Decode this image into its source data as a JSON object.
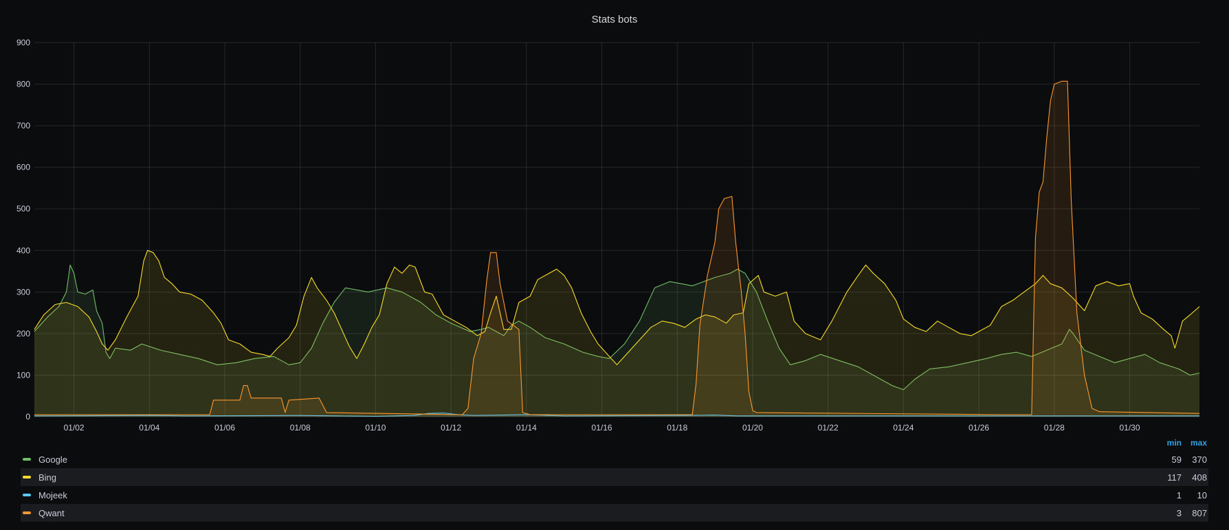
{
  "chart_data": {
    "type": "area",
    "title": "Stats bots",
    "xlabel": "",
    "ylabel": "",
    "x_ticks": [
      "01/02",
      "01/04",
      "01/06",
      "01/08",
      "01/10",
      "01/12",
      "01/14",
      "01/16",
      "01/18",
      "01/20",
      "01/22",
      "01/24",
      "01/26",
      "01/28",
      "01/30"
    ],
    "x_range": [
      0.95,
      31.85
    ],
    "y_ticks": [
      0,
      100,
      200,
      300,
      400,
      500,
      600,
      700,
      800,
      900
    ],
    "ylim": [
      0,
      900
    ],
    "grid": true,
    "legend_placement": "bottom",
    "legend_columns": [
      "min",
      "max"
    ],
    "series": [
      {
        "name": "Google",
        "color": "#73bf69",
        "min": 59,
        "max": 370,
        "points": [
          [
            0.95,
            205
          ],
          [
            1.3,
            240
          ],
          [
            1.6,
            265
          ],
          [
            1.8,
            300
          ],
          [
            1.9,
            365
          ],
          [
            2.0,
            345
          ],
          [
            2.1,
            300
          ],
          [
            2.3,
            295
          ],
          [
            2.5,
            305
          ],
          [
            2.6,
            255
          ],
          [
            2.75,
            225
          ],
          [
            2.85,
            155
          ],
          [
            2.95,
            140
          ],
          [
            3.1,
            165
          ],
          [
            3.5,
            160
          ],
          [
            3.8,
            175
          ],
          [
            4.3,
            160
          ],
          [
            4.8,
            150
          ],
          [
            5.3,
            140
          ],
          [
            5.8,
            125
          ],
          [
            6.3,
            130
          ],
          [
            6.8,
            140
          ],
          [
            7.3,
            145
          ],
          [
            7.7,
            125
          ],
          [
            8.0,
            130
          ],
          [
            8.3,
            165
          ],
          [
            8.6,
            225
          ],
          [
            8.9,
            275
          ],
          [
            9.2,
            310
          ],
          [
            9.5,
            305
          ],
          [
            9.8,
            300
          ],
          [
            10.3,
            310
          ],
          [
            10.7,
            300
          ],
          [
            11.2,
            275
          ],
          [
            11.6,
            245
          ],
          [
            12.0,
            225
          ],
          [
            12.5,
            205
          ],
          [
            12.8,
            210
          ],
          [
            13.0,
            215
          ],
          [
            13.2,
            205
          ],
          [
            13.4,
            195
          ],
          [
            13.6,
            220
          ],
          [
            13.8,
            230
          ],
          [
            14.1,
            215
          ],
          [
            14.5,
            190
          ],
          [
            15.0,
            175
          ],
          [
            15.5,
            155
          ],
          [
            15.9,
            145
          ],
          [
            16.2,
            140
          ],
          [
            16.6,
            175
          ],
          [
            17.0,
            230
          ],
          [
            17.4,
            310
          ],
          [
            17.8,
            325
          ],
          [
            18.1,
            320
          ],
          [
            18.4,
            315
          ],
          [
            18.7,
            325
          ],
          [
            19.0,
            335
          ],
          [
            19.4,
            345
          ],
          [
            19.6,
            355
          ],
          [
            19.8,
            345
          ],
          [
            20.1,
            300
          ],
          [
            20.4,
            230
          ],
          [
            20.7,
            165
          ],
          [
            21.0,
            125
          ],
          [
            21.4,
            135
          ],
          [
            21.8,
            150
          ],
          [
            22.3,
            135
          ],
          [
            22.8,
            120
          ],
          [
            23.3,
            95
          ],
          [
            23.7,
            75
          ],
          [
            24.0,
            65
          ],
          [
            24.3,
            90
          ],
          [
            24.7,
            115
          ],
          [
            25.2,
            120
          ],
          [
            25.7,
            130
          ],
          [
            26.2,
            140
          ],
          [
            26.6,
            150
          ],
          [
            27.0,
            155
          ],
          [
            27.4,
            145
          ],
          [
            27.8,
            160
          ],
          [
            28.2,
            175
          ],
          [
            28.4,
            210
          ],
          [
            28.5,
            200
          ],
          [
            28.8,
            160
          ],
          [
            29.2,
            145
          ],
          [
            29.6,
            130
          ],
          [
            30.0,
            140
          ],
          [
            30.4,
            150
          ],
          [
            30.8,
            130
          ],
          [
            31.3,
            115
          ],
          [
            31.6,
            100
          ],
          [
            31.85,
            105
          ]
        ]
      },
      {
        "name": "Bing",
        "color": "#fade2a",
        "min": 117,
        "max": 408,
        "points": [
          [
            0.95,
            210
          ],
          [
            1.2,
            245
          ],
          [
            1.5,
            270
          ],
          [
            1.8,
            275
          ],
          [
            2.1,
            265
          ],
          [
            2.4,
            240
          ],
          [
            2.6,
            205
          ],
          [
            2.75,
            175
          ],
          [
            2.9,
            160
          ],
          [
            3.1,
            185
          ],
          [
            3.4,
            240
          ],
          [
            3.7,
            290
          ],
          [
            3.85,
            375
          ],
          [
            3.95,
            400
          ],
          [
            4.1,
            395
          ],
          [
            4.25,
            375
          ],
          [
            4.4,
            335
          ],
          [
            4.6,
            320
          ],
          [
            4.8,
            300
          ],
          [
            5.1,
            295
          ],
          [
            5.4,
            280
          ],
          [
            5.7,
            250
          ],
          [
            5.9,
            225
          ],
          [
            6.1,
            185
          ],
          [
            6.4,
            175
          ],
          [
            6.7,
            155
          ],
          [
            7.0,
            150
          ],
          [
            7.2,
            145
          ],
          [
            7.4,
            165
          ],
          [
            7.7,
            190
          ],
          [
            7.9,
            220
          ],
          [
            8.1,
            290
          ],
          [
            8.3,
            335
          ],
          [
            8.45,
            310
          ],
          [
            8.7,
            280
          ],
          [
            8.9,
            250
          ],
          [
            9.1,
            210
          ],
          [
            9.3,
            170
          ],
          [
            9.5,
            140
          ],
          [
            9.7,
            175
          ],
          [
            9.9,
            215
          ],
          [
            10.1,
            245
          ],
          [
            10.3,
            320
          ],
          [
            10.5,
            360
          ],
          [
            10.7,
            345
          ],
          [
            10.9,
            365
          ],
          [
            11.05,
            360
          ],
          [
            11.3,
            300
          ],
          [
            11.5,
            295
          ],
          [
            11.8,
            245
          ],
          [
            12.1,
            230
          ],
          [
            12.4,
            215
          ],
          [
            12.7,
            195
          ],
          [
            12.9,
            205
          ],
          [
            13.05,
            250
          ],
          [
            13.2,
            290
          ],
          [
            13.4,
            210
          ],
          [
            13.6,
            210
          ],
          [
            13.8,
            275
          ],
          [
            14.1,
            290
          ],
          [
            14.3,
            330
          ],
          [
            14.6,
            345
          ],
          [
            14.8,
            355
          ],
          [
            15.0,
            340
          ],
          [
            15.2,
            310
          ],
          [
            15.45,
            250
          ],
          [
            15.7,
            205
          ],
          [
            15.9,
            175
          ],
          [
            16.2,
            145
          ],
          [
            16.4,
            125
          ],
          [
            16.7,
            155
          ],
          [
            17.0,
            185
          ],
          [
            17.3,
            215
          ],
          [
            17.6,
            230
          ],
          [
            17.9,
            225
          ],
          [
            18.2,
            215
          ],
          [
            18.5,
            235
          ],
          [
            18.75,
            245
          ],
          [
            19.0,
            240
          ],
          [
            19.3,
            225
          ],
          [
            19.5,
            245
          ],
          [
            19.75,
            250
          ],
          [
            19.9,
            320
          ],
          [
            20.15,
            340
          ],
          [
            20.3,
            300
          ],
          [
            20.6,
            290
          ],
          [
            20.9,
            300
          ],
          [
            21.1,
            230
          ],
          [
            21.4,
            200
          ],
          [
            21.8,
            185
          ],
          [
            22.1,
            230
          ],
          [
            22.5,
            300
          ],
          [
            22.8,
            340
          ],
          [
            23.0,
            365
          ],
          [
            23.2,
            345
          ],
          [
            23.5,
            320
          ],
          [
            23.8,
            280
          ],
          [
            24.0,
            235
          ],
          [
            24.3,
            215
          ],
          [
            24.6,
            205
          ],
          [
            24.9,
            230
          ],
          [
            25.2,
            215
          ],
          [
            25.5,
            200
          ],
          [
            25.8,
            195
          ],
          [
            26.0,
            205
          ],
          [
            26.3,
            220
          ],
          [
            26.6,
            265
          ],
          [
            26.9,
            280
          ],
          [
            27.2,
            300
          ],
          [
            27.5,
            320
          ],
          [
            27.7,
            340
          ],
          [
            27.9,
            320
          ],
          [
            28.2,
            310
          ],
          [
            28.5,
            285
          ],
          [
            28.8,
            255
          ],
          [
            29.1,
            315
          ],
          [
            29.4,
            325
          ],
          [
            29.7,
            315
          ],
          [
            30.0,
            320
          ],
          [
            30.1,
            290
          ],
          [
            30.3,
            250
          ],
          [
            30.6,
            235
          ],
          [
            30.9,
            210
          ],
          [
            31.1,
            195
          ],
          [
            31.2,
            165
          ],
          [
            31.4,
            230
          ],
          [
            31.6,
            245
          ],
          [
            31.85,
            265
          ]
        ]
      },
      {
        "name": "Mojeek",
        "color": "#5ac8fa",
        "min": 1,
        "max": 10,
        "points": [
          [
            0.95,
            2
          ],
          [
            4.0,
            3
          ],
          [
            5.0,
            2
          ],
          [
            8.0,
            3
          ],
          [
            9.0,
            2
          ],
          [
            10.0,
            1
          ],
          [
            11.0,
            3
          ],
          [
            11.4,
            8
          ],
          [
            11.8,
            9
          ],
          [
            12.2,
            5
          ],
          [
            12.6,
            3
          ],
          [
            14.0,
            5
          ],
          [
            15.0,
            2
          ],
          [
            18.0,
            3
          ],
          [
            19.0,
            4
          ],
          [
            19.6,
            2
          ],
          [
            31.85,
            2
          ]
        ]
      },
      {
        "name": "Qwant",
        "color": "#ff9830",
        "min": 3,
        "max": 807,
        "points": [
          [
            0.95,
            5
          ],
          [
            5.6,
            5
          ],
          [
            5.7,
            40
          ],
          [
            6.4,
            40
          ],
          [
            6.5,
            75
          ],
          [
            6.6,
            75
          ],
          [
            6.7,
            45
          ],
          [
            7.5,
            45
          ],
          [
            7.6,
            10
          ],
          [
            7.7,
            40
          ],
          [
            8.5,
            45
          ],
          [
            8.7,
            10
          ],
          [
            12.3,
            5
          ],
          [
            12.45,
            20
          ],
          [
            12.6,
            140
          ],
          [
            12.8,
            200
          ],
          [
            12.95,
            330
          ],
          [
            13.05,
            395
          ],
          [
            13.2,
            395
          ],
          [
            13.3,
            320
          ],
          [
            13.5,
            230
          ],
          [
            13.8,
            210
          ],
          [
            13.9,
            10
          ],
          [
            14.1,
            5
          ],
          [
            18.4,
            5
          ],
          [
            18.5,
            80
          ],
          [
            18.6,
            220
          ],
          [
            18.8,
            340
          ],
          [
            19.0,
            420
          ],
          [
            19.1,
            500
          ],
          [
            19.25,
            525
          ],
          [
            19.45,
            530
          ],
          [
            19.55,
            420
          ],
          [
            19.7,
            300
          ],
          [
            19.8,
            200
          ],
          [
            19.9,
            60
          ],
          [
            20.0,
            15
          ],
          [
            20.1,
            10
          ],
          [
            26.6,
            5
          ],
          [
            27.4,
            5
          ],
          [
            27.5,
            430
          ],
          [
            27.6,
            540
          ],
          [
            27.7,
            565
          ],
          [
            27.8,
            670
          ],
          [
            27.9,
            760
          ],
          [
            28.0,
            800
          ],
          [
            28.2,
            807
          ],
          [
            28.35,
            807
          ],
          [
            28.45,
            520
          ],
          [
            28.6,
            250
          ],
          [
            28.8,
            100
          ],
          [
            29.0,
            20
          ],
          [
            29.2,
            12
          ],
          [
            31.85,
            8
          ]
        ]
      }
    ]
  }
}
